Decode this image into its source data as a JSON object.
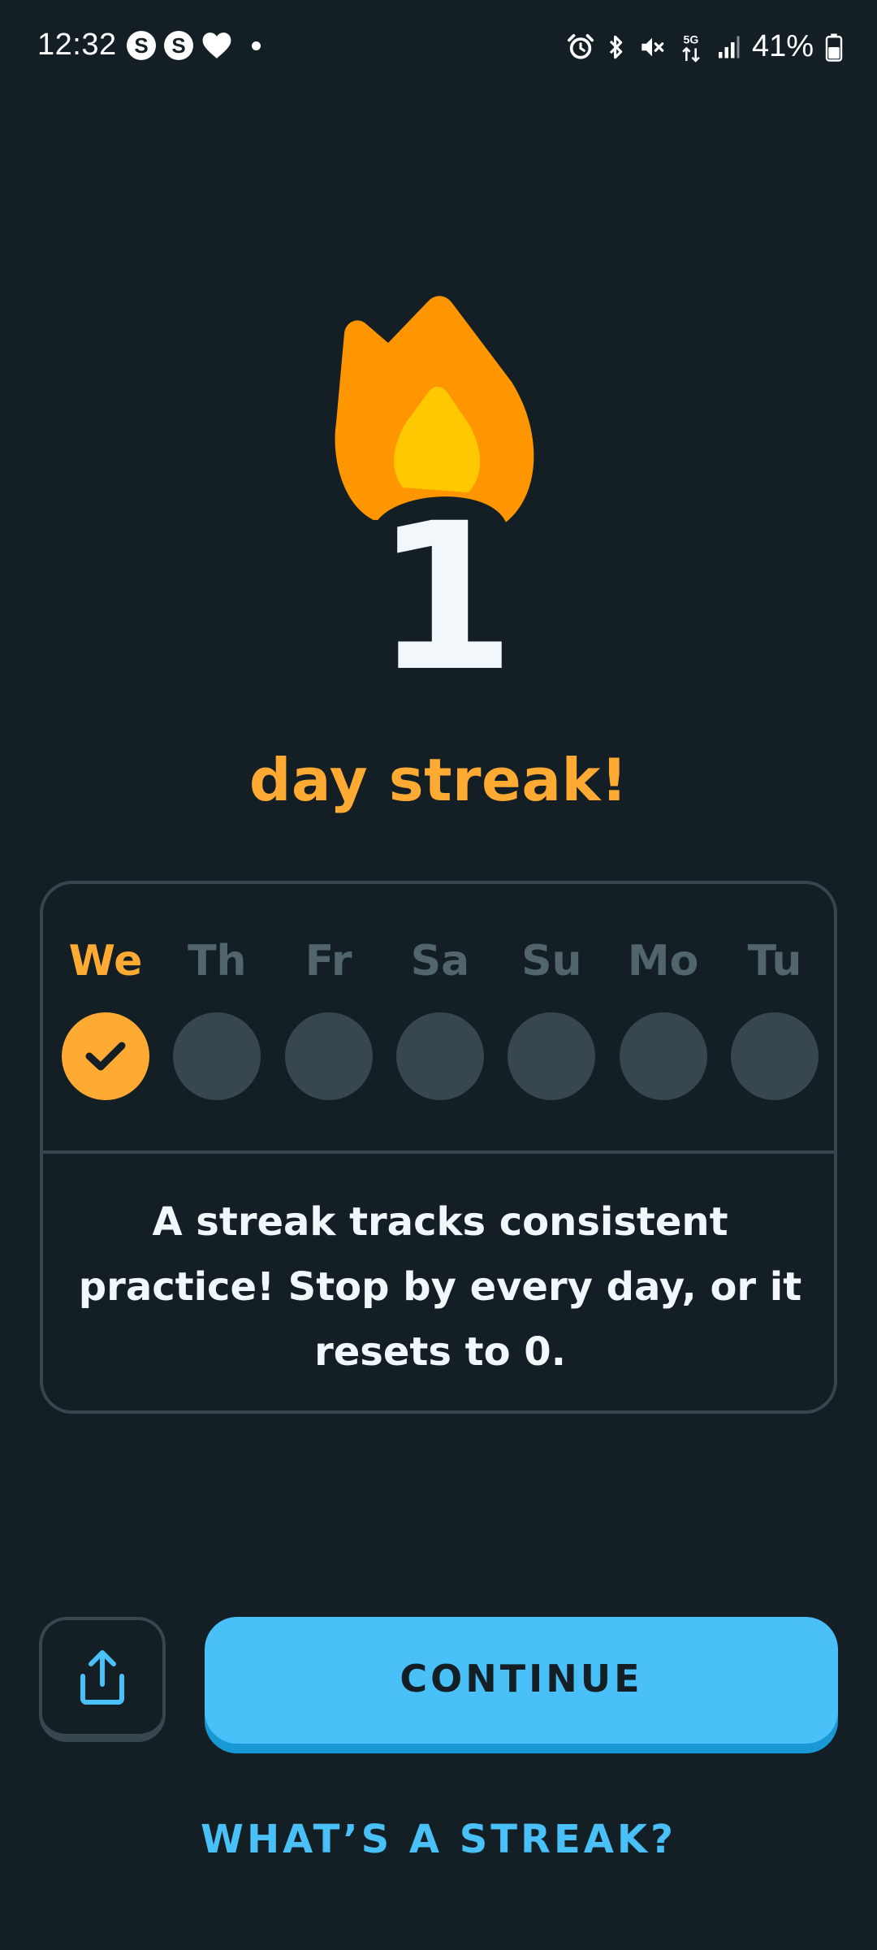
{
  "status_bar": {
    "time": "12:32",
    "notification_badges": [
      "S",
      "S"
    ],
    "battery_percent": "41%",
    "network": "5G",
    "icons": [
      "alarm-icon",
      "bluetooth-icon",
      "mute-icon",
      "5g-icon",
      "signal-icon",
      "battery-icon"
    ]
  },
  "streak": {
    "count": "1",
    "label": "day streak!"
  },
  "week": {
    "days": [
      {
        "label": "We",
        "completed": true
      },
      {
        "label": "Th",
        "completed": false
      },
      {
        "label": "Fr",
        "completed": false
      },
      {
        "label": "Sa",
        "completed": false
      },
      {
        "label": "Su",
        "completed": false
      },
      {
        "label": "Mo",
        "completed": false
      },
      {
        "label": "Tu",
        "completed": false
      }
    ],
    "description": "A streak tracks consistent practice! Stop by every day, or it resets to 0."
  },
  "actions": {
    "share_icon": "share-icon",
    "continue_label": "CONTINUE",
    "whats_streak_label": "WHAT’S A STREAK?"
  },
  "colors": {
    "background": "#131f24",
    "accent_orange": "#ffaa32",
    "flame_orange": "#ff9600",
    "flame_yellow": "#ffc800",
    "button_blue": "#49c0f8",
    "button_blue_shadow": "#1899d6",
    "inactive_gray": "#37464f",
    "inactive_text": "#52656d"
  }
}
